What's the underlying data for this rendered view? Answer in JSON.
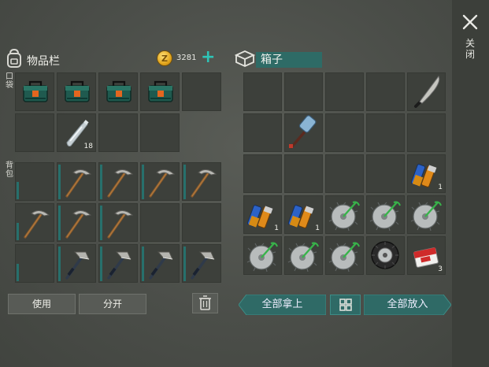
{
  "inventory": {
    "title": "物品栏",
    "coin_icon_symbol": "Z",
    "coin_count": "3281",
    "add_icon": "plus-icon",
    "pocket_label": "口袋",
    "backpack_label": "背包"
  },
  "pocket_items": [
    {
      "icon": "toolbox-icon",
      "count": ""
    },
    {
      "icon": "toolbox-icon",
      "count": ""
    },
    {
      "icon": "toolbox-icon",
      "count": ""
    },
    {
      "icon": "toolbox-icon",
      "count": ""
    },
    {
      "icon": "",
      "count": ""
    },
    {
      "icon": "",
      "count": ""
    },
    {
      "icon": "water-bottle-icon",
      "count": "18"
    },
    {
      "icon": "",
      "count": ""
    },
    {
      "icon": "",
      "count": ""
    }
  ],
  "backpack_items": [
    {
      "icon": "",
      "count": ""
    },
    {
      "icon": "pickaxe-icon",
      "count": ""
    },
    {
      "icon": "pickaxe-icon",
      "count": ""
    },
    {
      "icon": "pickaxe-icon",
      "count": ""
    },
    {
      "icon": "pickaxe-icon",
      "count": ""
    },
    {
      "icon": "pickaxe-icon",
      "count": ""
    },
    {
      "icon": "pickaxe-icon",
      "count": ""
    },
    {
      "icon": "pickaxe-icon",
      "count": ""
    },
    {
      "icon": "",
      "count": ""
    },
    {
      "icon": "",
      "count": ""
    },
    {
      "icon": "",
      "count": ""
    },
    {
      "icon": "hatchet-icon",
      "count": ""
    },
    {
      "icon": "hatchet-icon",
      "count": ""
    },
    {
      "icon": "hatchet-icon",
      "count": ""
    },
    {
      "icon": "hatchet-icon",
      "count": ""
    }
  ],
  "box": {
    "title": "箱子",
    "items": [
      {
        "icon": "",
        "count": ""
      },
      {
        "icon": "",
        "count": ""
      },
      {
        "icon": "",
        "count": ""
      },
      {
        "icon": "",
        "count": ""
      },
      {
        "icon": "machete-icon",
        "count": ""
      },
      {
        "icon": "",
        "count": ""
      },
      {
        "icon": "sledgehammer-icon",
        "count": ""
      },
      {
        "icon": "",
        "count": ""
      },
      {
        "icon": "",
        "count": ""
      },
      {
        "icon": "",
        "count": ""
      },
      {
        "icon": "",
        "count": ""
      },
      {
        "icon": "",
        "count": ""
      },
      {
        "icon": "",
        "count": ""
      },
      {
        "icon": "",
        "count": ""
      },
      {
        "icon": "batteries-icon",
        "count": "1"
      },
      {
        "icon": "batteries-icon",
        "count": "1"
      },
      {
        "icon": "batteries-icon",
        "count": "1"
      },
      {
        "icon": "saw-blade-icon",
        "count": ""
      },
      {
        "icon": "saw-blade-icon",
        "count": ""
      },
      {
        "icon": "saw-blade-icon",
        "count": ""
      },
      {
        "icon": "saw-blade-icon",
        "count": ""
      },
      {
        "icon": "saw-blade-icon",
        "count": ""
      },
      {
        "icon": "saw-blade-icon",
        "count": ""
      },
      {
        "icon": "tire-icon",
        "count": ""
      },
      {
        "icon": "cigarette-pack-icon",
        "count": "3"
      }
    ]
  },
  "buttons": {
    "use": "使用",
    "split": "分开",
    "take_all": "全部拿上",
    "put_all": "全部放入",
    "sort_icon": "grid-sort-icon",
    "trash_icon": "trash-icon"
  },
  "close": {
    "label": "关闭",
    "icon": "close-icon"
  }
}
